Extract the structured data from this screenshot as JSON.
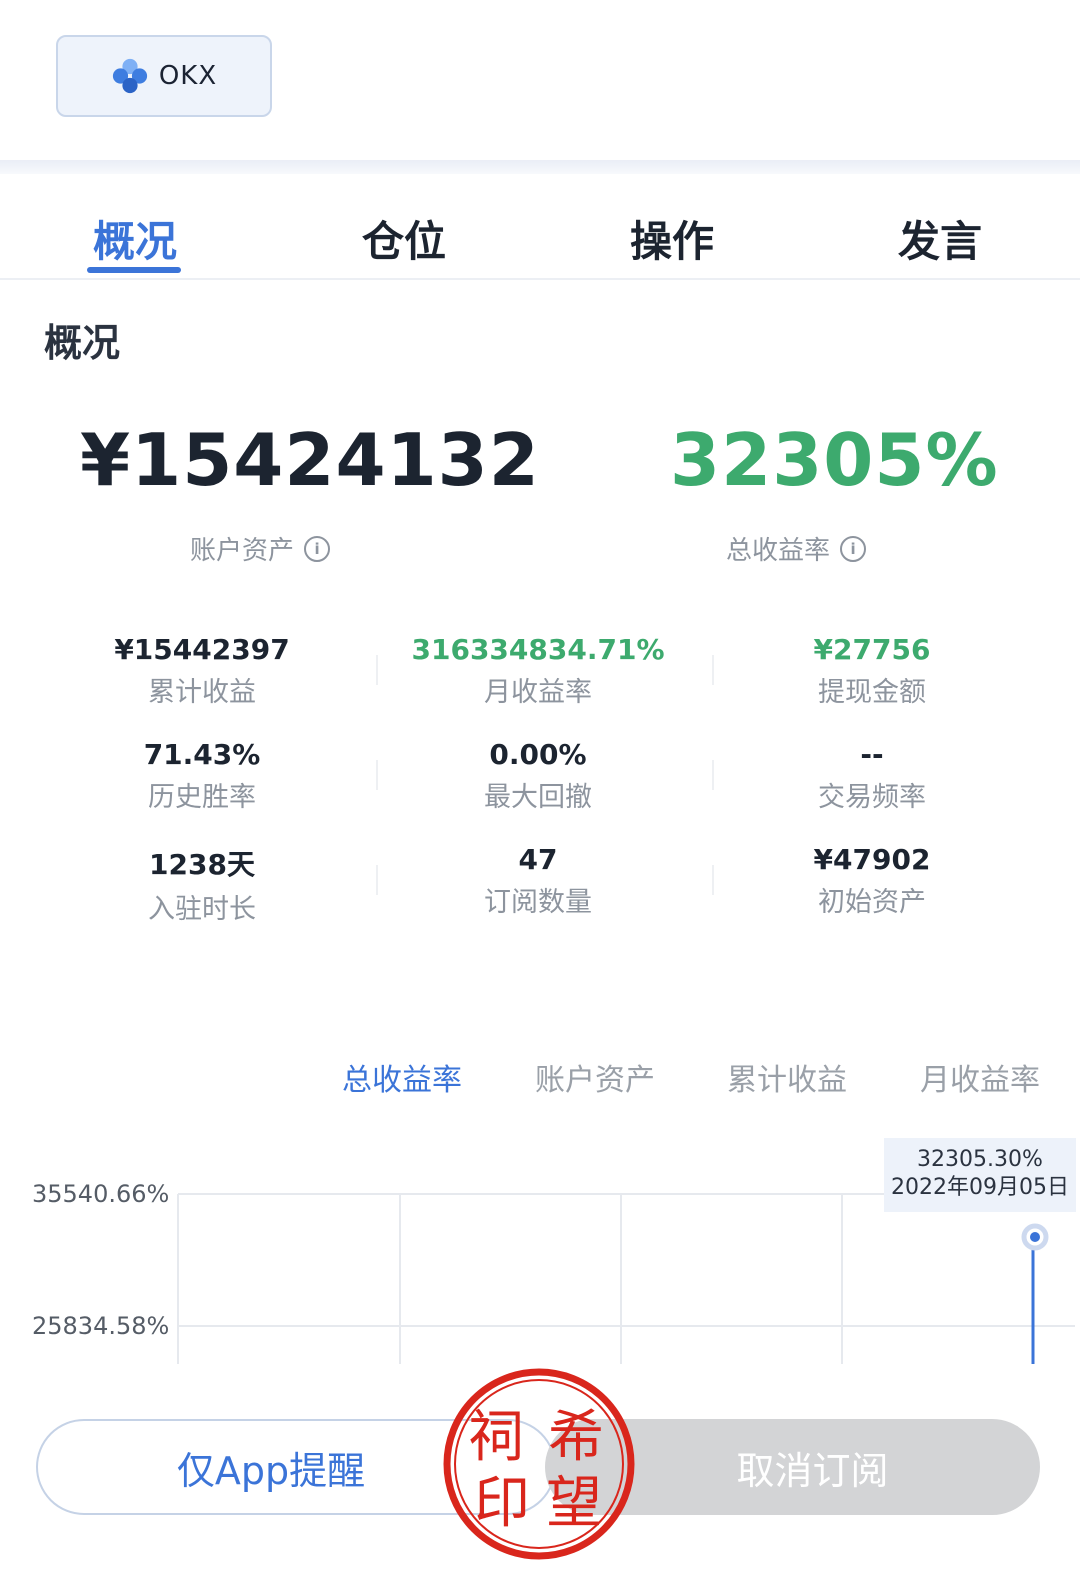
{
  "exchange": {
    "name": "OKX",
    "logo_icon": "okx-logo-icon"
  },
  "tabs": [
    {
      "label": "概况",
      "active": true
    },
    {
      "label": "仓位",
      "active": false
    },
    {
      "label": "操作",
      "active": false
    },
    {
      "label": "发言",
      "active": false
    }
  ],
  "overview": {
    "title": "概况",
    "account_assets": {
      "value": "¥15424132",
      "label": "账户资产"
    },
    "total_return": {
      "value": "32305%",
      "label": "总收益率"
    },
    "stats": [
      {
        "value": "¥15442397",
        "label": "累计收益",
        "color": "#1c2430"
      },
      {
        "value": "316334834.71%",
        "label": "月收益率",
        "color": "#3daa6e"
      },
      {
        "value": "¥27756",
        "label": "提现金额",
        "color": "#3daa6e"
      },
      {
        "value": "71.43%",
        "label": "历史胜率",
        "color": "#1c2430"
      },
      {
        "value": "0.00%",
        "label": "最大回撤",
        "color": "#1c2430"
      },
      {
        "value": "--",
        "label": "交易频率",
        "color": "#1c2430"
      },
      {
        "value": "1238天",
        "label": "入驻时长",
        "color": "#1c2430"
      },
      {
        "value": "47",
        "label": "订阅数量",
        "color": "#1c2430"
      },
      {
        "value": "¥47902",
        "label": "初始资产",
        "color": "#1c2430"
      }
    ]
  },
  "chart": {
    "tabs": [
      {
        "label": "总收益率",
        "active": true
      },
      {
        "label": "账户资产",
        "active": false
      },
      {
        "label": "累计收益",
        "active": false
      },
      {
        "label": "月收益率",
        "active": false
      }
    ],
    "y_ticks": [
      "35540.66%",
      "25834.58%"
    ],
    "tooltip": {
      "value": "32305.30%",
      "date": "2022年09月05日"
    }
  },
  "chart_data": {
    "type": "line",
    "title": "",
    "series": [
      {
        "values": [
          32305.3
        ]
      }
    ],
    "x": [
      "2022年09月05日"
    ],
    "ylim_ticks": [
      25834.58,
      35540.66
    ],
    "grid": true
  },
  "buttons": {
    "remind": "仅App提醒",
    "cancel": "取消订阅"
  },
  "stamp": {
    "text": "祠希印望"
  },
  "colors": {
    "accent": "#3b74d8",
    "positive": "#3daa6e",
    "stamp": "#d9261c"
  }
}
